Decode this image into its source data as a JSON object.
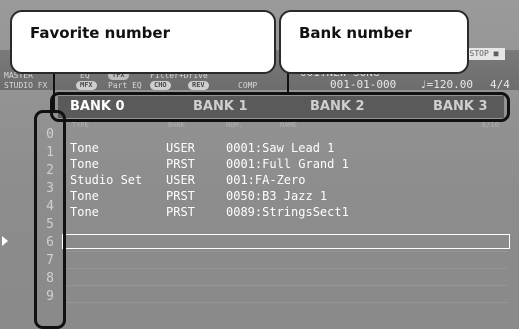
{
  "status": {
    "left_top": "MASTER",
    "eq": "EQ",
    "tfx": "TFX",
    "filter": "Filter+Drive",
    "left_bottom": "STUDIO FX",
    "mfx": "MFX",
    "part_eq": "Part EQ",
    "cho": "CHO",
    "rev": "REV",
    "comp": "COMP",
    "song_name": "001:NEW SONG",
    "position": "001-01-000",
    "tempo": "♩=120.00",
    "time_sig": "4/4",
    "stop": "STOP"
  },
  "banks": [
    "BANK 0",
    "BANK 1",
    "BANK 2",
    "BANK 3"
  ],
  "columns": {
    "type": "TYPE",
    "bank": "BANK",
    "num": "NUM.",
    "name": "NAME",
    "page": "6/10"
  },
  "numbers": [
    "0",
    "1",
    "2",
    "3",
    "4",
    "5",
    "6",
    "7",
    "8",
    "9"
  ],
  "rows": [
    {
      "type": "Tone",
      "bank": "USER",
      "name": "0001:Saw Lead 1"
    },
    {
      "type": "Tone",
      "bank": "PRST",
      "name": "0001:Full Grand 1"
    },
    {
      "type": "Studio Set",
      "bank": "USER",
      "name": "001:FA-Zero"
    },
    {
      "type": "Tone",
      "bank": "PRST",
      "name": "0050:B3 Jazz 1"
    },
    {
      "type": "Tone",
      "bank": "PRST",
      "name": "0089:StringsSect1"
    }
  ],
  "callouts": {
    "favorite": "Favorite number",
    "bank": "Bank number"
  }
}
